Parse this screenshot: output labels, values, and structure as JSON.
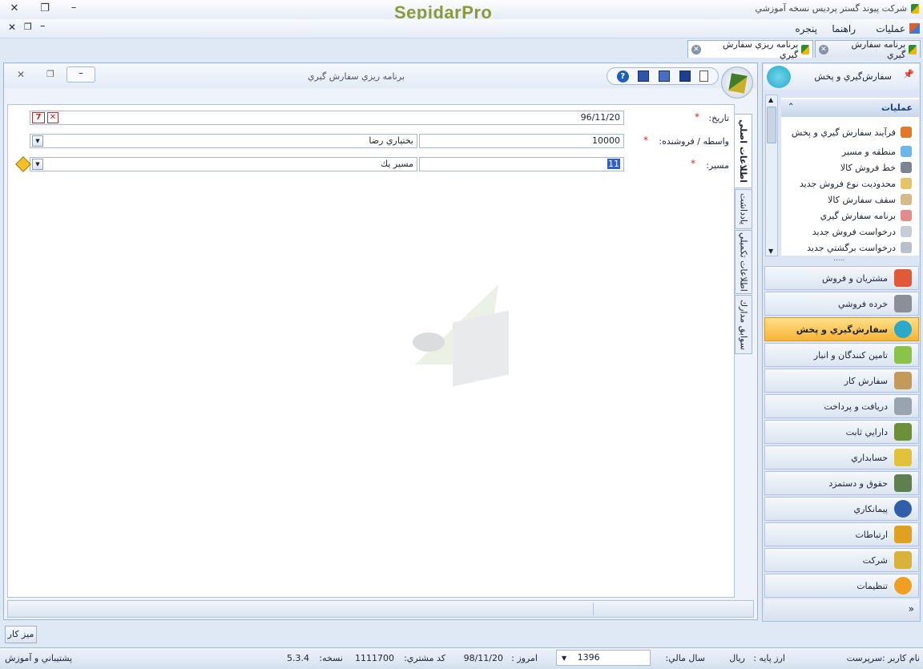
{
  "window": {
    "title": "شركت پيوند گستر پرديس نسخه آموزشي",
    "logo": "SepidarPro"
  },
  "menu": {
    "items": [
      "عمليات",
      "راهنما",
      "پنجره"
    ]
  },
  "tabs": [
    {
      "label": "برنامه سفارش گيري",
      "active": false
    },
    {
      "label": "برنامه ريزي سفارش گيري",
      "active": true
    }
  ],
  "document": {
    "title": "برنامه ريزي سفارش گيري",
    "fields": {
      "date_label": "تاريخ:",
      "date_value": "96/11/20",
      "agent_label": "واسطه / فروشنده:",
      "agent_code": "10000",
      "agent_name": "بختياري رضا",
      "route_label": "مسير:",
      "route_code": "11",
      "route_name": "مسير يك"
    },
    "side_tabs": [
      "اطلاعات اصلي",
      "يادداشت",
      "اطلاعات تكميلي",
      "سوابق مدارك"
    ]
  },
  "right_panel": {
    "header": "سفارش‌گيري و پخش",
    "ops_title": "عمليات",
    "ops": [
      "فرآيند سفارش گيري و پخش",
      "منطقه و مسير",
      "خط فروش كالا",
      "محدوديت نوع فروش جديد",
      "سقف سفارش كالا",
      "برنامه سفارش گيري",
      "درخواست فروش جديد",
      "درخواست برگشتي جديد"
    ],
    "modules": [
      {
        "label": "مشتريان و فروش",
        "color": "#e05a3a"
      },
      {
        "label": "خرده فروشي",
        "color": "#8b8f98"
      },
      {
        "label": "سفارش‌گيري و پخش",
        "color": "#2aa9c9",
        "active": true
      },
      {
        "label": "تامين كنندگان و انبار",
        "color": "#8bc34a"
      },
      {
        "label": "سفارش كار",
        "color": "#c49a5a"
      },
      {
        "label": "دريافت و پرداخت",
        "color": "#9aa4b0"
      },
      {
        "label": "دارايي ثابت",
        "color": "#6d8f3a"
      },
      {
        "label": "حسابداري",
        "color": "#e2c23a"
      },
      {
        "label": "حقوق و دستمزد",
        "color": "#5f7f4f"
      },
      {
        "label": "پيمانكاري",
        "color": "#2f5fa8"
      },
      {
        "label": "ارتباطات",
        "color": "#e0a020"
      },
      {
        "label": "شركت",
        "color": "#d9b23a"
      },
      {
        "label": "تنظيمات",
        "color": "#f0a020"
      }
    ]
  },
  "taskbar": {
    "desk_label": "ميز كار"
  },
  "status": {
    "user": "نام كاربر :سرپرست",
    "base_currency_label": "ارز پايه :",
    "base_currency": "ريال",
    "fiscal_year_label": "سال مالي:",
    "fiscal_year": "1396",
    "today_label": "امروز :",
    "today": "98/11/20",
    "customer_code_label": "كد مشتري:",
    "customer_code": "1111700",
    "version_label": "نسخه:",
    "version": "5.3.4",
    "support": "پشتيباني و آموزش"
  }
}
